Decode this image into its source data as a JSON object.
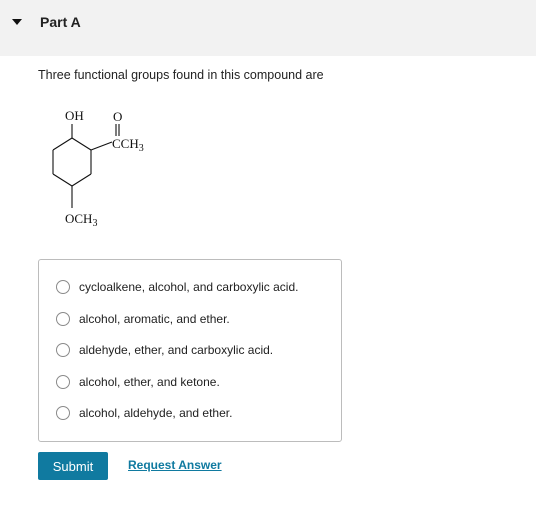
{
  "header": {
    "title": "Part A"
  },
  "question": {
    "prompt": "Three functional groups found in this compound are"
  },
  "structure": {
    "oh": "OH",
    "carbonyl_o": "O",
    "cch3_c": "C",
    "cch3_ch": "CH",
    "cch3_sub": "3",
    "och3_o": "OCH",
    "och3_sub": "3"
  },
  "choices": [
    {
      "label": "cycloalkene, alcohol, and carboxylic acid."
    },
    {
      "label": "alcohol, aromatic, and ether."
    },
    {
      "label": "aldehyde, ether, and carboxylic acid."
    },
    {
      "label": "alcohol, ether, and ketone."
    },
    {
      "label": "alcohol, aldehyde, and ether."
    }
  ],
  "actions": {
    "submit": "Submit",
    "request_answer": "Request Answer"
  },
  "colors": {
    "accent": "#107aa0",
    "header_bg": "#f2f2f2"
  },
  "icons": {
    "collapse": "caret-down-icon"
  }
}
